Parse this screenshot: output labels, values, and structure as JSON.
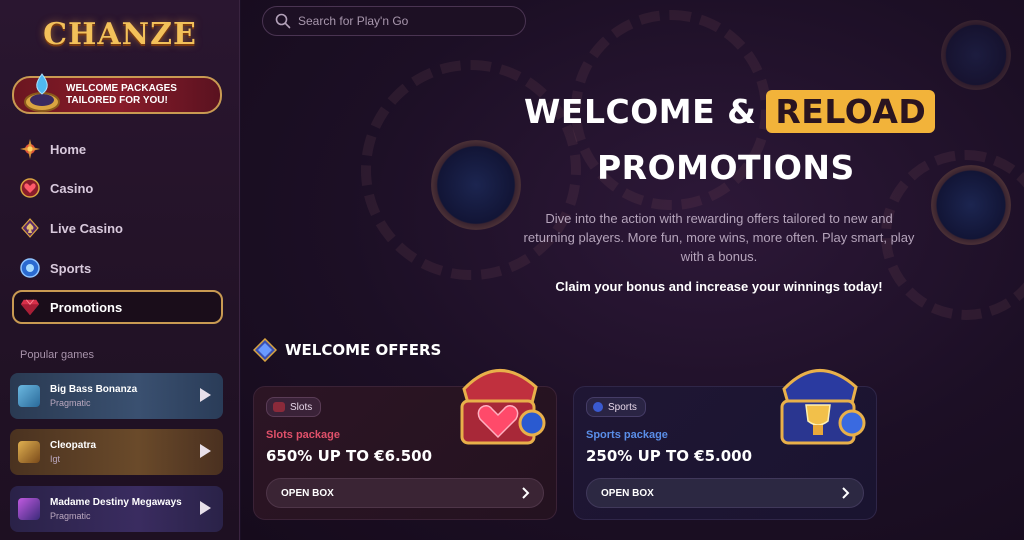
{
  "brand": {
    "logo_text": "CHANZE"
  },
  "sidebar": {
    "welcome_banner": "WELCOME PACKAGES TAILORED FOR YOU!",
    "nav": [
      {
        "label": "Home",
        "icon": "compass-icon"
      },
      {
        "label": "Casino",
        "icon": "heart-chip-icon"
      },
      {
        "label": "Live Casino",
        "icon": "spade-icon"
      },
      {
        "label": "Sports",
        "icon": "ball-icon"
      },
      {
        "label": "Promotions",
        "icon": "diamond-icon",
        "active": true
      }
    ],
    "popular_label": "Popular games",
    "popular_games": [
      {
        "title": "Big Bass Bonanza",
        "provider": "Pragmatic"
      },
      {
        "title": "Cleopatra",
        "provider": "Igt"
      },
      {
        "title": "Madame Destiny Megaways",
        "provider": "Pragmatic"
      }
    ]
  },
  "search": {
    "placeholder": "Search for Play'n Go"
  },
  "hero": {
    "title_part1": "WELCOME &",
    "title_highlight": "RELOAD",
    "title_part2": "PROMOTIONS",
    "description": "Dive into the action with rewarding offers tailored to new and returning players. More fun, more wins, more often. Play smart, play with a bonus.",
    "claim": "Claim your bonus and increase your winnings today!"
  },
  "offers": {
    "heading": "WELCOME OFFERS",
    "cards": [
      {
        "tag": "Slots",
        "package_label": "Slots package",
        "value": "650% UP TO €6.500",
        "button": "OPEN BOX",
        "accent": "#e0506a"
      },
      {
        "tag": "Sports",
        "package_label": "Sports package",
        "value": "250% UP TO €5.000",
        "button": "OPEN BOX",
        "accent": "#5a8ee8"
      }
    ]
  },
  "colors": {
    "gold": "#c99a52",
    "highlight": "#f2b33a",
    "bg": "#1a0f24"
  }
}
